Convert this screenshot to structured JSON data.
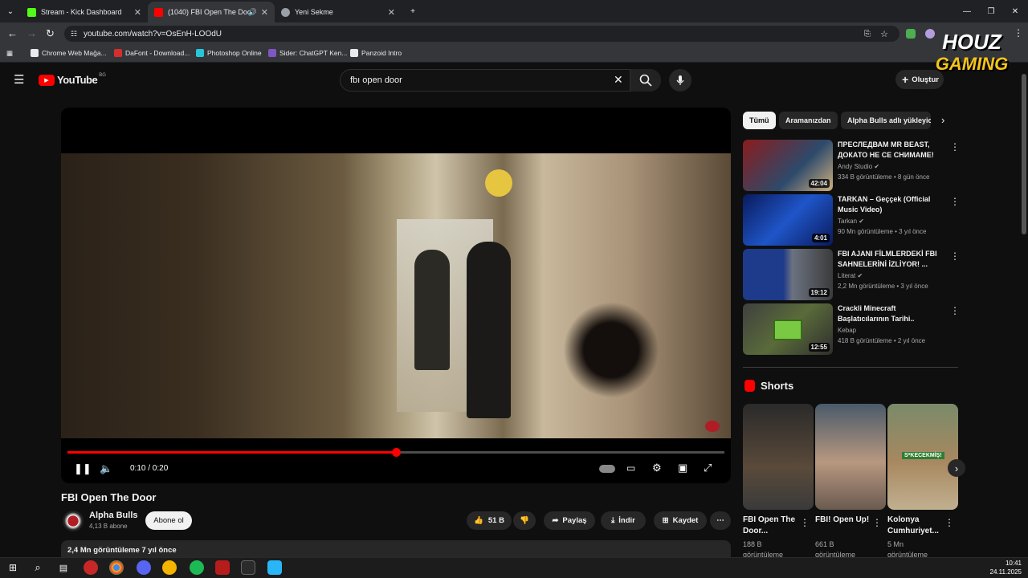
{
  "browser": {
    "tabs": [
      {
        "label": "Stream - Kick Dashboard",
        "color": "#53fc18"
      },
      {
        "label": "(1040) FBI Open The Door",
        "color": "#ff0000"
      },
      {
        "label": "Yeni Sekme",
        "color": "#9aa0a6"
      }
    ],
    "url": "youtube.com/watch?v=OsEnH-LOOdU",
    "bookmarks": [
      "Chrome Web Mağa...",
      "DaFont - Download...",
      "Photoshop Online",
      "Sider: ChatGPT Ken...",
      "Panzoid Intro"
    ]
  },
  "youtube": {
    "logo_text": "YouTube",
    "region": "BG",
    "search_value": "fbı open door",
    "create_label": "Oluştur",
    "player": {
      "time": "0:10 / 0:20",
      "progress": 0.5
    },
    "video": {
      "title": "FBI Open The Door",
      "channel": "Alpha Bulls",
      "subscribers": "4,13 B abone",
      "subscribe_label": "Abone ol",
      "likes": "51 B",
      "share_label": "Paylaş",
      "download_label": "İndir",
      "save_label": "Kaydet",
      "views_date": "2,4 Mn görüntüleme  7 yıl önce"
    },
    "chips": [
      "Tümü",
      "Aramanızdan",
      "Alpha Bulls adlı yükleyic"
    ],
    "recommendations": [
      {
        "title": "ПРЕСЛЕДВАМ MR BEAST, ДОКАТО НЕ СЕ СНИМАМЕ!",
        "channel": "Andy Studio",
        "meta": "334 B görüntüleme • 8 gün önce",
        "duration": "42:04",
        "verified": true
      },
      {
        "title": "TARKAN – Geççek (Official Music Video)",
        "channel": "Tarkan",
        "meta": "90 Mn görüntüleme • 3 yıl önce",
        "duration": "4:01",
        "verified": true
      },
      {
        "title": "FBI AJANI FİLMLERDEKİ FBI SAHNELERİNİ İZLİYOR! ...",
        "channel": "Literat",
        "meta": "2,2 Mn görüntüleme • 3 yıl önce",
        "duration": "19:12",
        "verified": true
      },
      {
        "title": "Crackli Minecraft Başlatıcılarının Tarihi..",
        "channel": "Kebap",
        "meta": "418 B görüntüleme • 2 yıl önce",
        "duration": "12:55",
        "verified": false
      }
    ],
    "shorts_heading": "Shorts",
    "shorts": [
      {
        "title": "FBI Open The Door...",
        "views": "188 B görüntüleme"
      },
      {
        "title": "FBI! Open Up!",
        "views": "661 B görüntüleme"
      },
      {
        "title": "Kolonya Cumhuriyet...",
        "views": "5 Mn görüntüleme",
        "overlay": "S*KECEKMİŞ!"
      }
    ]
  },
  "overlay": {
    "line1": "HOUZ",
    "line2": "GAMING"
  },
  "taskbar": {
    "time": "10:41",
    "date": "24.11.2025"
  }
}
